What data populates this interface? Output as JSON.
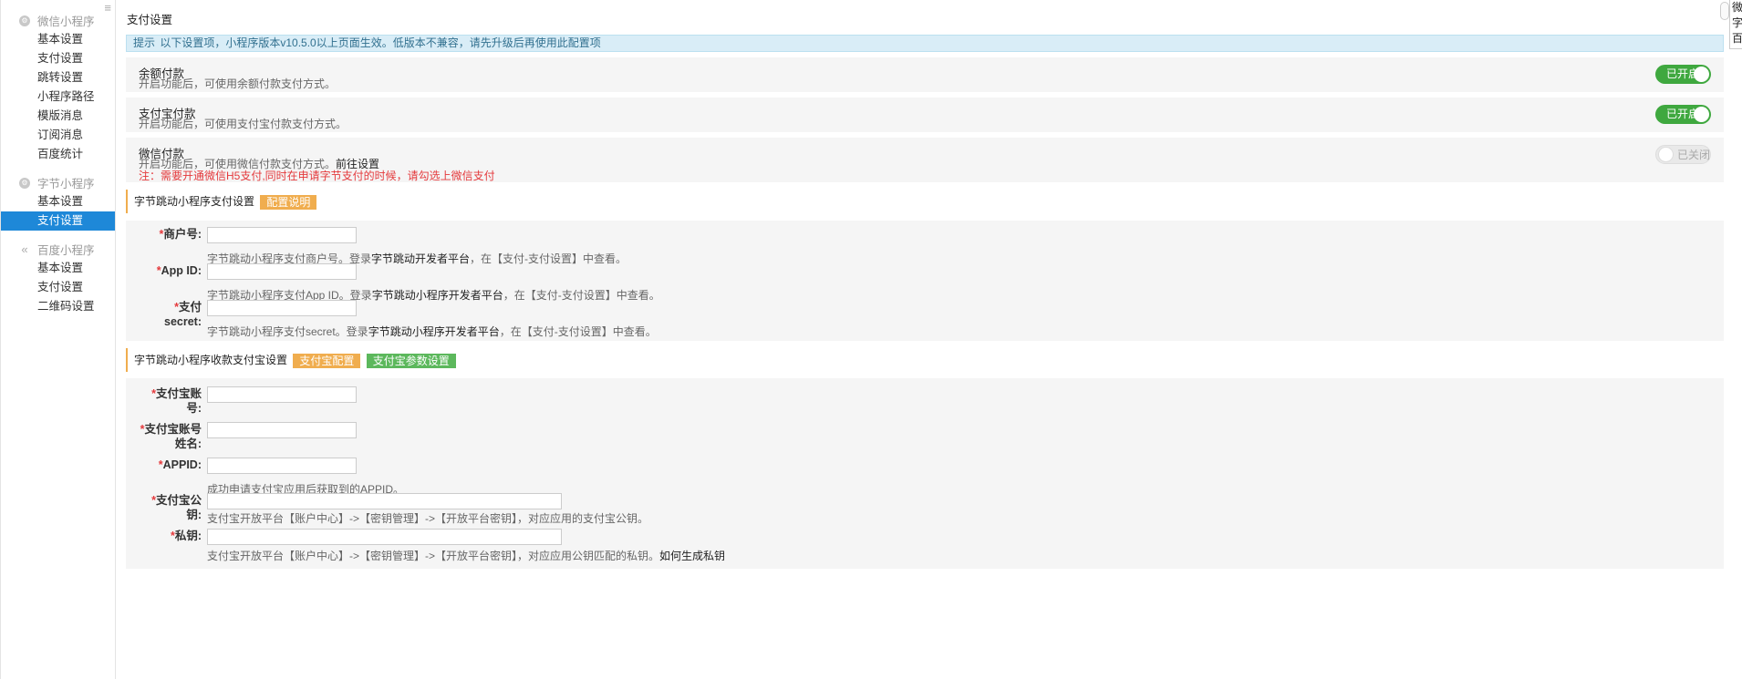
{
  "sidebar": {
    "toggle_icon": "menu-icon",
    "groups": [
      {
        "title": "微信小程序",
        "icon": "circle-icon",
        "items": [
          "基本设置",
          "支付设置",
          "跳转设置",
          "小程序路径",
          "模版消息",
          "订阅消息",
          "百度统计"
        ]
      },
      {
        "title": "字节小程序",
        "icon": "circle-icon",
        "items": [
          "基本设置",
          "支付设置"
        ],
        "active_index": 1
      },
      {
        "title": "百度小程序",
        "icon": "double-chevron-left-icon",
        "items": [
          "基本设置",
          "支付设置",
          "二维码设置"
        ]
      }
    ]
  },
  "page": {
    "title": "支付设置",
    "notice_label": "提示",
    "notice_text": "以下设置项，小程序版本v10.5.0以上页面生效。低版本不兼容，请先升级后再使用此配置项"
  },
  "payments": [
    {
      "title": "余额付款",
      "desc": "开启功能后，可使用余额付款支付方式。",
      "switch": "已开启",
      "on": true
    },
    {
      "title": "支付宝付款",
      "desc": "开启功能后，可使用支付宝付款支付方式。",
      "switch": "已开启",
      "on": true
    },
    {
      "title": "微信付款",
      "desc": "开启功能后，可使用微信付款支付方式。",
      "link": "前往设置",
      "warn": "注：需要开通微信H5支付,同时在申请字节支付的时候，请勾选上微信支付",
      "switch": "已关闭",
      "on": false
    }
  ],
  "bytedance_pay": {
    "heading": "字节跳动小程序支付设置",
    "tag": "配置说明",
    "fields": [
      {
        "label": "商户号:",
        "value": "",
        "help_pre": "字节跳动小程序支付商户号。登录",
        "help_bold": "字节跳动开发者平台",
        "help_post": "，在【支付-支付设置】中查看。"
      },
      {
        "label": "App ID:",
        "value": "",
        "help_pre": "字节跳动小程序支付App ID。登录",
        "help_bold": "字节跳动小程序开发者平台",
        "help_post": "，在【支付-支付设置】中查看。"
      },
      {
        "label_line1": "支付",
        "label_line2": "secret:",
        "value": "",
        "help_pre": "字节跳动小程序支付secret。登录",
        "help_bold": "字节跳动小程序开发者平台",
        "help_post": "，在【支付-支付设置】中查看。"
      }
    ]
  },
  "alipay": {
    "heading": "字节跳动小程序收款支付宝设置",
    "tag1": "支付宝配置",
    "tag2": "支付宝参数设置",
    "fields": [
      {
        "label_line1": "支付宝账",
        "label_line2": "号:",
        "value": ""
      },
      {
        "label_line1": "支付宝账号",
        "label_line2": "姓名:",
        "value": ""
      },
      {
        "label": "APPID:",
        "value": "",
        "help": "成功申请支付宝应用后获取到的APPID。"
      },
      {
        "label_line1": "支付宝公",
        "label_line2": "钥:",
        "value": "",
        "help": "支付宝开放平台【账户中心】->【密钥管理】->【开放平台密钥】，对应应用的支付宝公钥。"
      },
      {
        "label": "私钥:",
        "value": "",
        "help": "支付宝开放平台【账户中心】->【密钥管理】->【开放平台密钥】，对应应用公钥匹配的私钥。",
        "help_link": "如何生成私钥"
      }
    ]
  },
  "right_edge": {
    "lines": [
      "微",
      "字",
      "百"
    ]
  },
  "colors": {
    "active_nav": "#1e88d8",
    "switch_on": "#3fa83f",
    "tag_orange": "#f0ad4e",
    "tag_green": "#5cb85c",
    "required": "#e4393c"
  }
}
